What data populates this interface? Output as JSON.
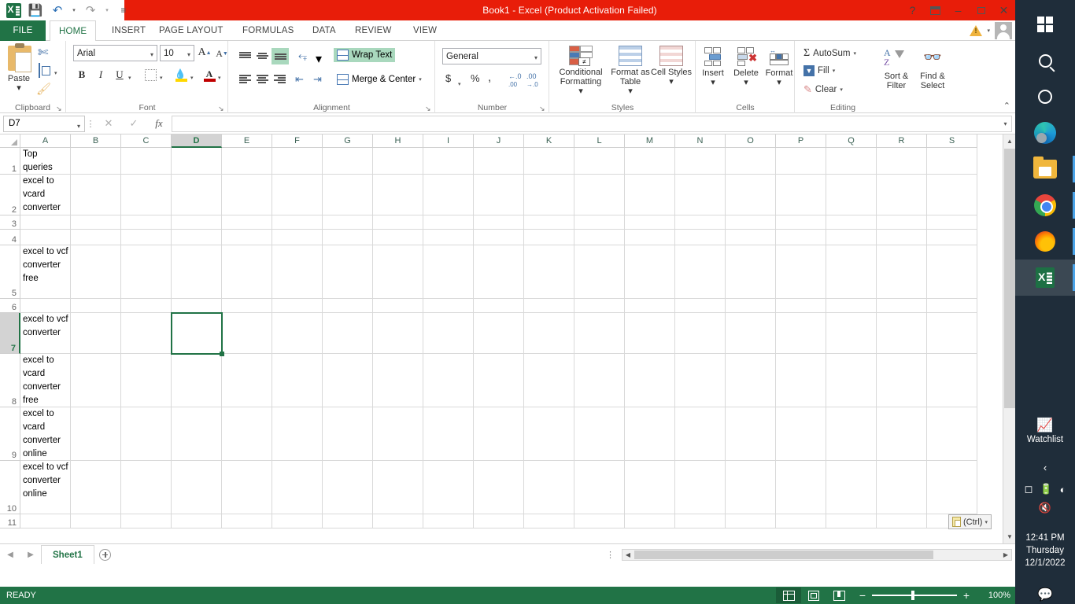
{
  "window": {
    "title": "Book1 -  Excel (Product Activation Failed)",
    "quick_access": [
      {
        "name": "excel-logo",
        "label": "X"
      },
      {
        "name": "save-button",
        "label": "💾"
      },
      {
        "name": "undo-button",
        "label": "↶"
      },
      {
        "name": "redo-button",
        "label": "↷"
      },
      {
        "name": "customize-qat-button",
        "label": "≡"
      }
    ],
    "controls": {
      "help": "?",
      "ribbon_display": "⤴",
      "minimize": "–",
      "restore": "❐",
      "close": "✕"
    },
    "account_warning": "!",
    "account_caret": "▾"
  },
  "ribbon": {
    "tabs": [
      {
        "label": "FILE",
        "active": false,
        "file": true
      },
      {
        "label": "HOME",
        "active": true
      },
      {
        "label": "INSERT",
        "active": false
      },
      {
        "label": "PAGE LAYOUT",
        "active": false
      },
      {
        "label": "FORMULAS",
        "active": false
      },
      {
        "label": "DATA",
        "active": false
      },
      {
        "label": "REVIEW",
        "active": false
      },
      {
        "label": "VIEW",
        "active": false
      }
    ],
    "collapse_icon": "⌃",
    "groups": {
      "clipboard": {
        "label": "Clipboard",
        "paste": "Paste",
        "paste_caret": "▾",
        "cut": "Cut",
        "copy": "Copy",
        "format_painter": "Format Painter",
        "launcher": "↘"
      },
      "font": {
        "label": "Font",
        "font_name": "Arial",
        "font_size": "10",
        "grow": "A",
        "shrink": "A",
        "bold": "B",
        "italic": "I",
        "underline": "U",
        "borders": "Borders",
        "fill_color": "Fill Color",
        "font_color": "A",
        "caret": "▾",
        "launcher": "↘"
      },
      "alignment": {
        "label": "Alignment",
        "wrap_text": "Wrap Text",
        "merge_center": "Merge & Center",
        "orientation_caret": "▾",
        "merge_caret": "▾",
        "launcher": "↘"
      },
      "number": {
        "label": "Number",
        "format": "General",
        "currency": "$",
        "percent": "%",
        "comma": ",",
        "inc_decimal": ".00",
        "dec_decimal": ".0",
        "caret": "▾",
        "launcher": "↘"
      },
      "styles": {
        "label": "Styles",
        "conditional_formatting": "Conditional Formatting",
        "format_as_table": "Format as Table",
        "cell_styles": "Cell Styles",
        "caret": "▾"
      },
      "cells": {
        "label": "Cells",
        "insert": "Insert",
        "delete": "Delete",
        "format": "Format",
        "caret": "▾"
      },
      "editing": {
        "label": "Editing",
        "autosum": "AutoSum",
        "fill": "Fill",
        "clear": "Clear",
        "sort_filter": "Sort & Filter",
        "find_select": "Find & Select",
        "caret": "▾",
        "sigma": "Σ"
      }
    }
  },
  "formula_bar": {
    "name_box": "D7",
    "cancel": "✕",
    "enter": "✓",
    "insert_function": "fx",
    "value": "",
    "expand": "▾",
    "more_dots": "⋮"
  },
  "grid": {
    "columns": [
      "A",
      "B",
      "C",
      "D",
      "E",
      "F",
      "G",
      "H",
      "I",
      "J",
      "K",
      "L",
      "M",
      "N",
      "O",
      "P",
      "Q",
      "R",
      "S"
    ],
    "selected_column": "D",
    "selected_row": 7,
    "selected_cell": "D7",
    "rows": [
      {
        "n": 1,
        "a": "Top queries"
      },
      {
        "n": 2,
        "a": "excel to vcard converter"
      },
      {
        "n": 3,
        "a": ""
      },
      {
        "n": 4,
        "a": ""
      },
      {
        "n": 5,
        "a": "excel to vcf converter free"
      },
      {
        "n": 6,
        "a": ""
      },
      {
        "n": 7,
        "a": "excel to vcf converter"
      },
      {
        "n": 8,
        "a": "excel to vcard converter free"
      },
      {
        "n": 9,
        "a": "excel to vcard converter online"
      },
      {
        "n": 10,
        "a": "excel to vcf converter online"
      },
      {
        "n": 11,
        "a": ""
      }
    ],
    "paste_tag": "(Ctrl)",
    "paste_tag_caret": "▾",
    "scroll_up": "▲",
    "scroll_down": "▼"
  },
  "sheet_bar": {
    "prev": "◀",
    "next": "▶",
    "tabs": [
      {
        "label": "Sheet1",
        "active": true
      }
    ],
    "add_sheet": "+",
    "left_arrow": "◀",
    "right_arrow": "▶"
  },
  "status_bar": {
    "status": "READY",
    "views": [
      {
        "name": "normal-view",
        "active": true
      },
      {
        "name": "page-layout-view",
        "active": false
      },
      {
        "name": "page-break-view",
        "active": false
      }
    ],
    "zoom_out": "−",
    "zoom_in": "+",
    "zoom_level": "100%"
  },
  "taskbar": {
    "items": [
      {
        "name": "start-button",
        "icon": "windows-logo-icon",
        "active": false,
        "running": false
      },
      {
        "name": "search-button",
        "icon": "search-icon",
        "active": false,
        "running": false
      },
      {
        "name": "cortana-button",
        "icon": "cortana-circle-icon",
        "active": false,
        "running": false
      },
      {
        "name": "edge-button",
        "icon": "edge-icon",
        "active": false,
        "running": false
      },
      {
        "name": "file-explorer-button",
        "icon": "folder-icon",
        "active": false,
        "running": true
      },
      {
        "name": "chrome-button",
        "icon": "chrome-icon",
        "active": false,
        "running": true
      },
      {
        "name": "firefox-button",
        "icon": "firefox-icon",
        "active": false,
        "running": true
      },
      {
        "name": "excel-button",
        "icon": "excel-icon",
        "active": true,
        "running": true
      }
    ],
    "watchlist_label": "Watchlist",
    "tray_expand": "‹",
    "tray_icons": [
      "camera-icon",
      "battery-icon",
      "wifi-icon",
      "volume-muted-icon"
    ],
    "clock": {
      "time": "12:41 PM",
      "day": "Thursday",
      "date": "12/1/2022"
    },
    "notifications_icon": "notification-icon"
  }
}
